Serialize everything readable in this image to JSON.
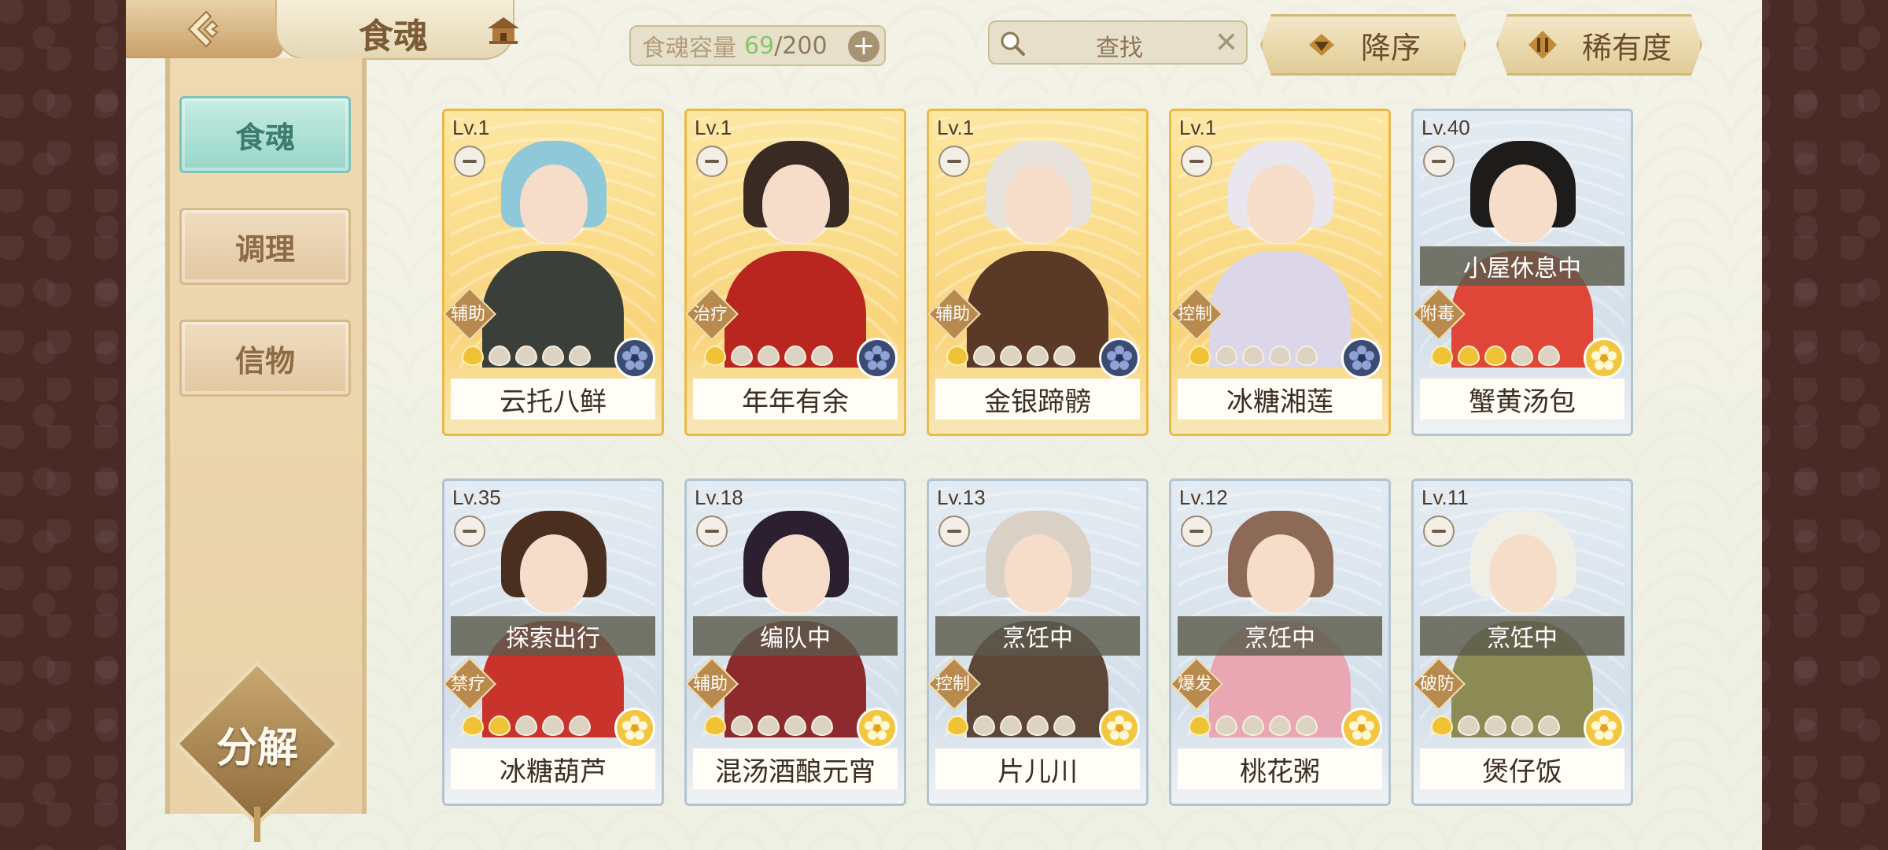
{
  "header": {
    "title": "食魂",
    "back_icon": "back-arrow-icon",
    "home_icon": "pavilion-home-icon",
    "capacity": {
      "label": "食魂容量",
      "current": "69",
      "max": "/200",
      "plus": "+"
    },
    "search": {
      "placeholder": "查找",
      "clear": "✕"
    },
    "sort_order": "降序",
    "sort_by": "稀有度"
  },
  "sidebar": {
    "tabs": [
      {
        "label": "食魂",
        "active": true
      },
      {
        "label": "调理",
        "active": false
      },
      {
        "label": "信物",
        "active": false
      }
    ],
    "decompose_label": "分解"
  },
  "cards": [
    {
      "level": "Lv.1",
      "role": "辅助",
      "name": "云托八鲜",
      "status": "",
      "stars_lit": 1,
      "frame": "gold",
      "badge": "dark",
      "hair": "#8fc8d8",
      "outfit": "#3a3f3a"
    },
    {
      "level": "Lv.1",
      "role": "治疗",
      "name": "年年有余",
      "status": "",
      "stars_lit": 1,
      "frame": "gold",
      "badge": "dark",
      "hair": "#3a2a24",
      "outfit": "#b8261f"
    },
    {
      "level": "Lv.1",
      "role": "辅助",
      "name": "金银蹄髈",
      "status": "",
      "stars_lit": 1,
      "frame": "gold",
      "badge": "dark",
      "hair": "#e8e2dc",
      "outfit": "#5a3a26"
    },
    {
      "level": "Lv.1",
      "role": "控制",
      "name": "冰糖湘莲",
      "status": "",
      "stars_lit": 1,
      "frame": "gold",
      "badge": "dark",
      "hair": "#e9e6ee",
      "outfit": "#dcd7e8"
    },
    {
      "level": "Lv.40",
      "role": "附毒",
      "name": "蟹黄汤包",
      "status": "小屋休息中",
      "stars_lit": 3,
      "frame": "blue",
      "badge": "gold",
      "hair": "#1e1b1b",
      "outfit": "#e04638"
    },
    {
      "level": "Lv.35",
      "role": "禁疗",
      "name": "冰糖葫芦",
      "status": "探索出行",
      "stars_lit": 2,
      "frame": "blue",
      "badge": "gold",
      "hair": "#4a2f20",
      "outfit": "#c8332b"
    },
    {
      "level": "Lv.18",
      "role": "辅助",
      "name": "混汤酒酿元宵",
      "status": "编队中",
      "stars_lit": 1,
      "frame": "blue",
      "badge": "gold",
      "hair": "#2c2030",
      "outfit": "#8d2a2d"
    },
    {
      "level": "Lv.13",
      "role": "控制",
      "name": "片儿川",
      "status": "烹饪中",
      "stars_lit": 1,
      "frame": "blue",
      "badge": "gold",
      "hair": "#d9d1c6",
      "outfit": "#5b4638"
    },
    {
      "level": "Lv.12",
      "role": "爆发",
      "name": "桃花粥",
      "status": "烹饪中",
      "stars_lit": 1,
      "frame": "blue",
      "badge": "gold",
      "hair": "#8c6a55",
      "outfit": "#e9a6b3"
    },
    {
      "level": "Lv.11",
      "role": "破防",
      "name": "煲仔饭",
      "status": "烹饪中",
      "stars_lit": 1,
      "frame": "blue",
      "badge": "gold",
      "hair": "#efefe6",
      "outfit": "#8c8a55"
    }
  ]
}
